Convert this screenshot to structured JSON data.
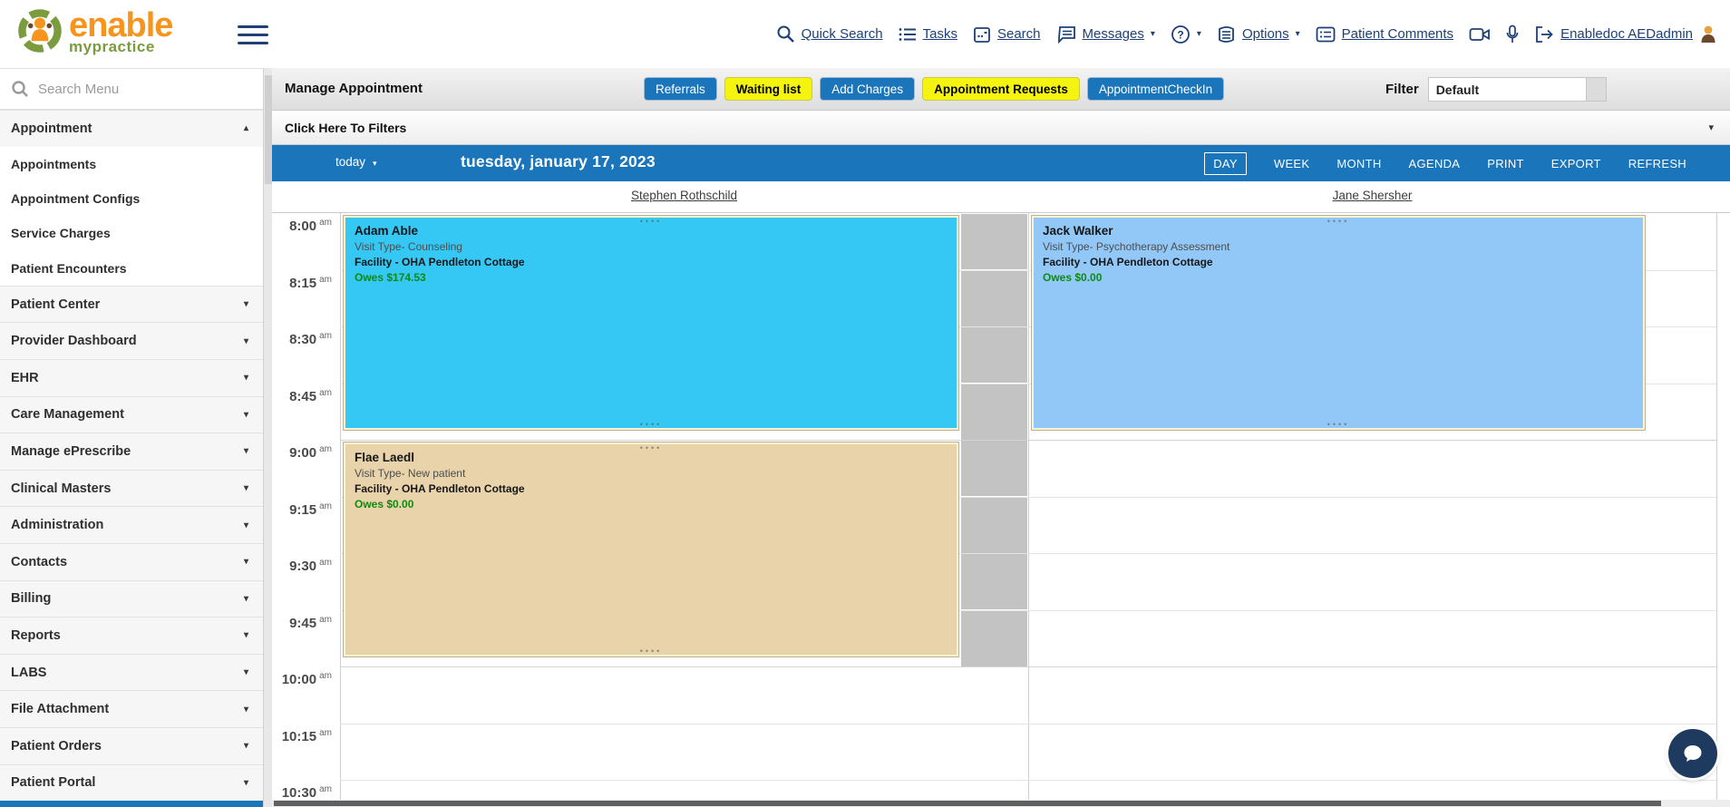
{
  "header": {
    "logo": {
      "line1": "enable",
      "line2": "mypractice"
    },
    "nav": [
      {
        "id": "quick-search",
        "label": "Quick Search",
        "icon": "search",
        "caret": false
      },
      {
        "id": "tasks",
        "label": "Tasks",
        "icon": "tasks",
        "caret": false
      },
      {
        "id": "search",
        "label": "Search",
        "icon": "calendar",
        "caret": false
      },
      {
        "id": "messages",
        "label": "Messages",
        "icon": "message",
        "caret": true
      },
      {
        "id": "help",
        "label": "",
        "icon": "help",
        "caret": true
      },
      {
        "id": "options",
        "label": "Options",
        "icon": "options",
        "caret": true
      },
      {
        "id": "patient-comments",
        "label": "Patient Comments",
        "icon": "comments",
        "caret": false
      },
      {
        "id": "video",
        "label": "",
        "icon": "video",
        "caret": false
      },
      {
        "id": "mic",
        "label": "",
        "icon": "mic",
        "caret": false
      },
      {
        "id": "user",
        "label": "Enabledoc AEDadmin",
        "icon": "logout",
        "caret": false,
        "avatar": true
      }
    ]
  },
  "sidebar": {
    "search_placeholder": "Search Menu",
    "menu": [
      {
        "label": "Appointment",
        "type": "section",
        "caret": "up"
      },
      {
        "label": "Appointments",
        "type": "item"
      },
      {
        "label": "Appointment Configs",
        "type": "item"
      },
      {
        "label": "Service Charges",
        "type": "item"
      },
      {
        "label": "Patient Encounters",
        "type": "item"
      },
      {
        "label": "Patient Center",
        "type": "section",
        "caret": "down"
      },
      {
        "label": "Provider Dashboard",
        "type": "section",
        "caret": "down"
      },
      {
        "label": "EHR",
        "type": "section",
        "caret": "down"
      },
      {
        "label": "Care Management",
        "type": "section",
        "caret": "down"
      },
      {
        "label": "Manage ePrescribe",
        "type": "section",
        "caret": "down"
      },
      {
        "label": "Clinical Masters",
        "type": "section",
        "caret": "down"
      },
      {
        "label": "Administration",
        "type": "section",
        "caret": "down"
      },
      {
        "label": "Contacts",
        "type": "section",
        "caret": "down"
      },
      {
        "label": "Billing",
        "type": "section",
        "caret": "down"
      },
      {
        "label": "Reports",
        "type": "section",
        "caret": "down"
      },
      {
        "label": "LABS",
        "type": "section",
        "caret": "down"
      },
      {
        "label": "File Attachment",
        "type": "section",
        "caret": "down"
      },
      {
        "label": "Patient Orders",
        "type": "section",
        "caret": "down"
      },
      {
        "label": "Patient Portal",
        "type": "section",
        "caret": "down"
      }
    ]
  },
  "toolbar": {
    "title": "Manage Appointment",
    "buttons": [
      {
        "label": "Referrals",
        "style": "blue"
      },
      {
        "label": "Waiting list",
        "style": "yellow"
      },
      {
        "label": "Add Charges",
        "style": "blue"
      },
      {
        "label": "Appointment Requests",
        "style": "yellow"
      },
      {
        "label": "AppointmentCheckIn",
        "style": "blue"
      }
    ],
    "filter_label": "Filter",
    "filter_value": "Default"
  },
  "filter_bar": {
    "label": "Click Here To Filters"
  },
  "calendar": {
    "today_label": "today",
    "date_label": "tuesday, january 17, 2023",
    "views": [
      "DAY",
      "WEEK",
      "MONTH",
      "AGENDA",
      "PRINT",
      "EXPORT",
      "REFRESH"
    ],
    "active_view": "DAY",
    "providers": [
      "Stephen Rothschild",
      "Jane Shersher"
    ],
    "time_slots": [
      "8:00",
      "8:15",
      "8:30",
      "8:45",
      "9:00",
      "9:15",
      "9:30",
      "9:45",
      "10:00",
      "10:15",
      "10:30"
    ],
    "time_period": "am",
    "appointments": [
      {
        "patient": "Adam Able",
        "visit_type": "Visit Type- Counseling",
        "facility": "Facility - OHA Pendleton Cottage",
        "owes": "Owes $174.53",
        "provider": "Stephen Rothschild",
        "start": "8:00",
        "end": "9:00",
        "color": "#35c8f5"
      },
      {
        "patient": "Flae Laedl",
        "visit_type": "Visit Type- New patient",
        "facility": "Facility - OHA Pendleton Cottage",
        "owes": "Owes $0.00",
        "provider": "Stephen Rothschild",
        "start": "9:00",
        "end": "10:00",
        "color": "#e9d3ab"
      },
      {
        "patient": "Jack Walker",
        "visit_type": "Visit Type- Psychotherapy Assessment",
        "facility": "Facility - OHA Pendleton Cottage",
        "owes": "Owes $0.00",
        "provider": "Jane Shersher",
        "start": "8:00",
        "end": "9:00",
        "color": "#92c8f7"
      }
    ],
    "blocked_time": {
      "provider": "Stephen Rothschild",
      "start": "8:00",
      "end": "10:00"
    }
  },
  "colors": {
    "primary_blue": "#1b75bb",
    "button_yellow": "#f4f410",
    "nav_navy": "#1d4077",
    "owes_green": "#0e8a0e",
    "blocked_gray": "#c3c3c3"
  }
}
